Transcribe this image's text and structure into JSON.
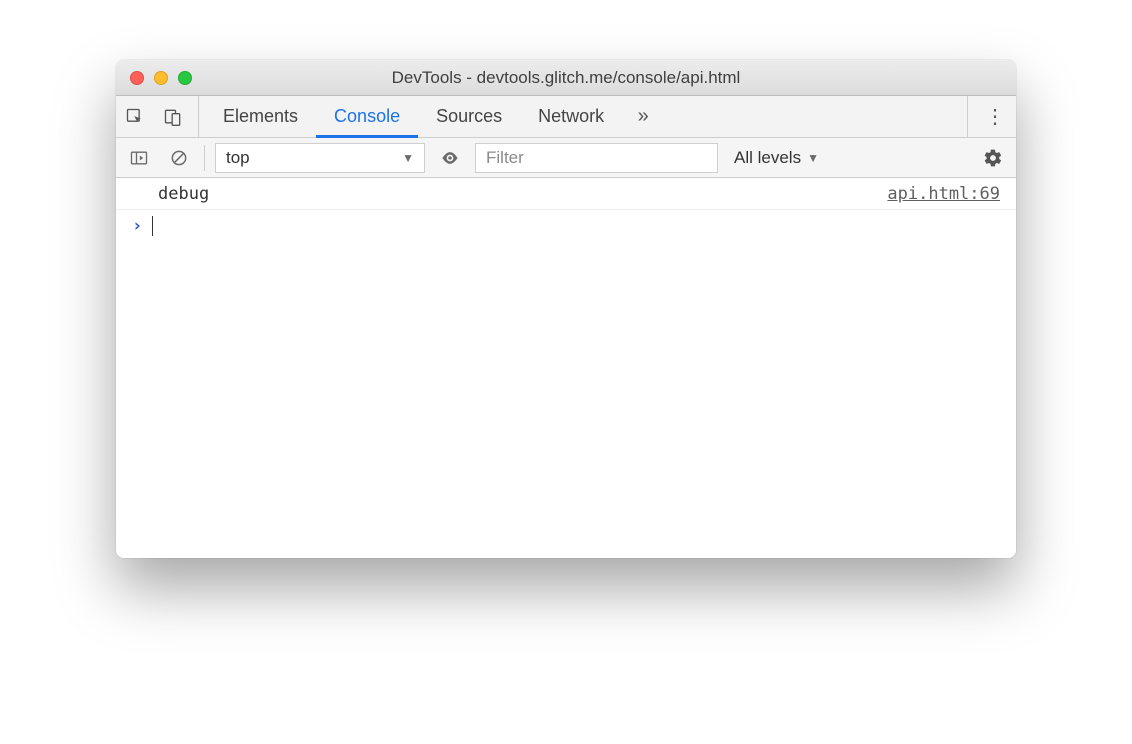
{
  "window": {
    "title": "DevTools - devtools.glitch.me/console/api.html"
  },
  "tabs": {
    "elements": "Elements",
    "console": "Console",
    "sources": "Sources",
    "network": "Network",
    "active": "console"
  },
  "toolbar": {
    "context_value": "top",
    "filter_placeholder": "Filter",
    "levels_label": "All levels"
  },
  "console": {
    "rows": [
      {
        "text": "debug",
        "source": "api.html:69"
      }
    ]
  }
}
